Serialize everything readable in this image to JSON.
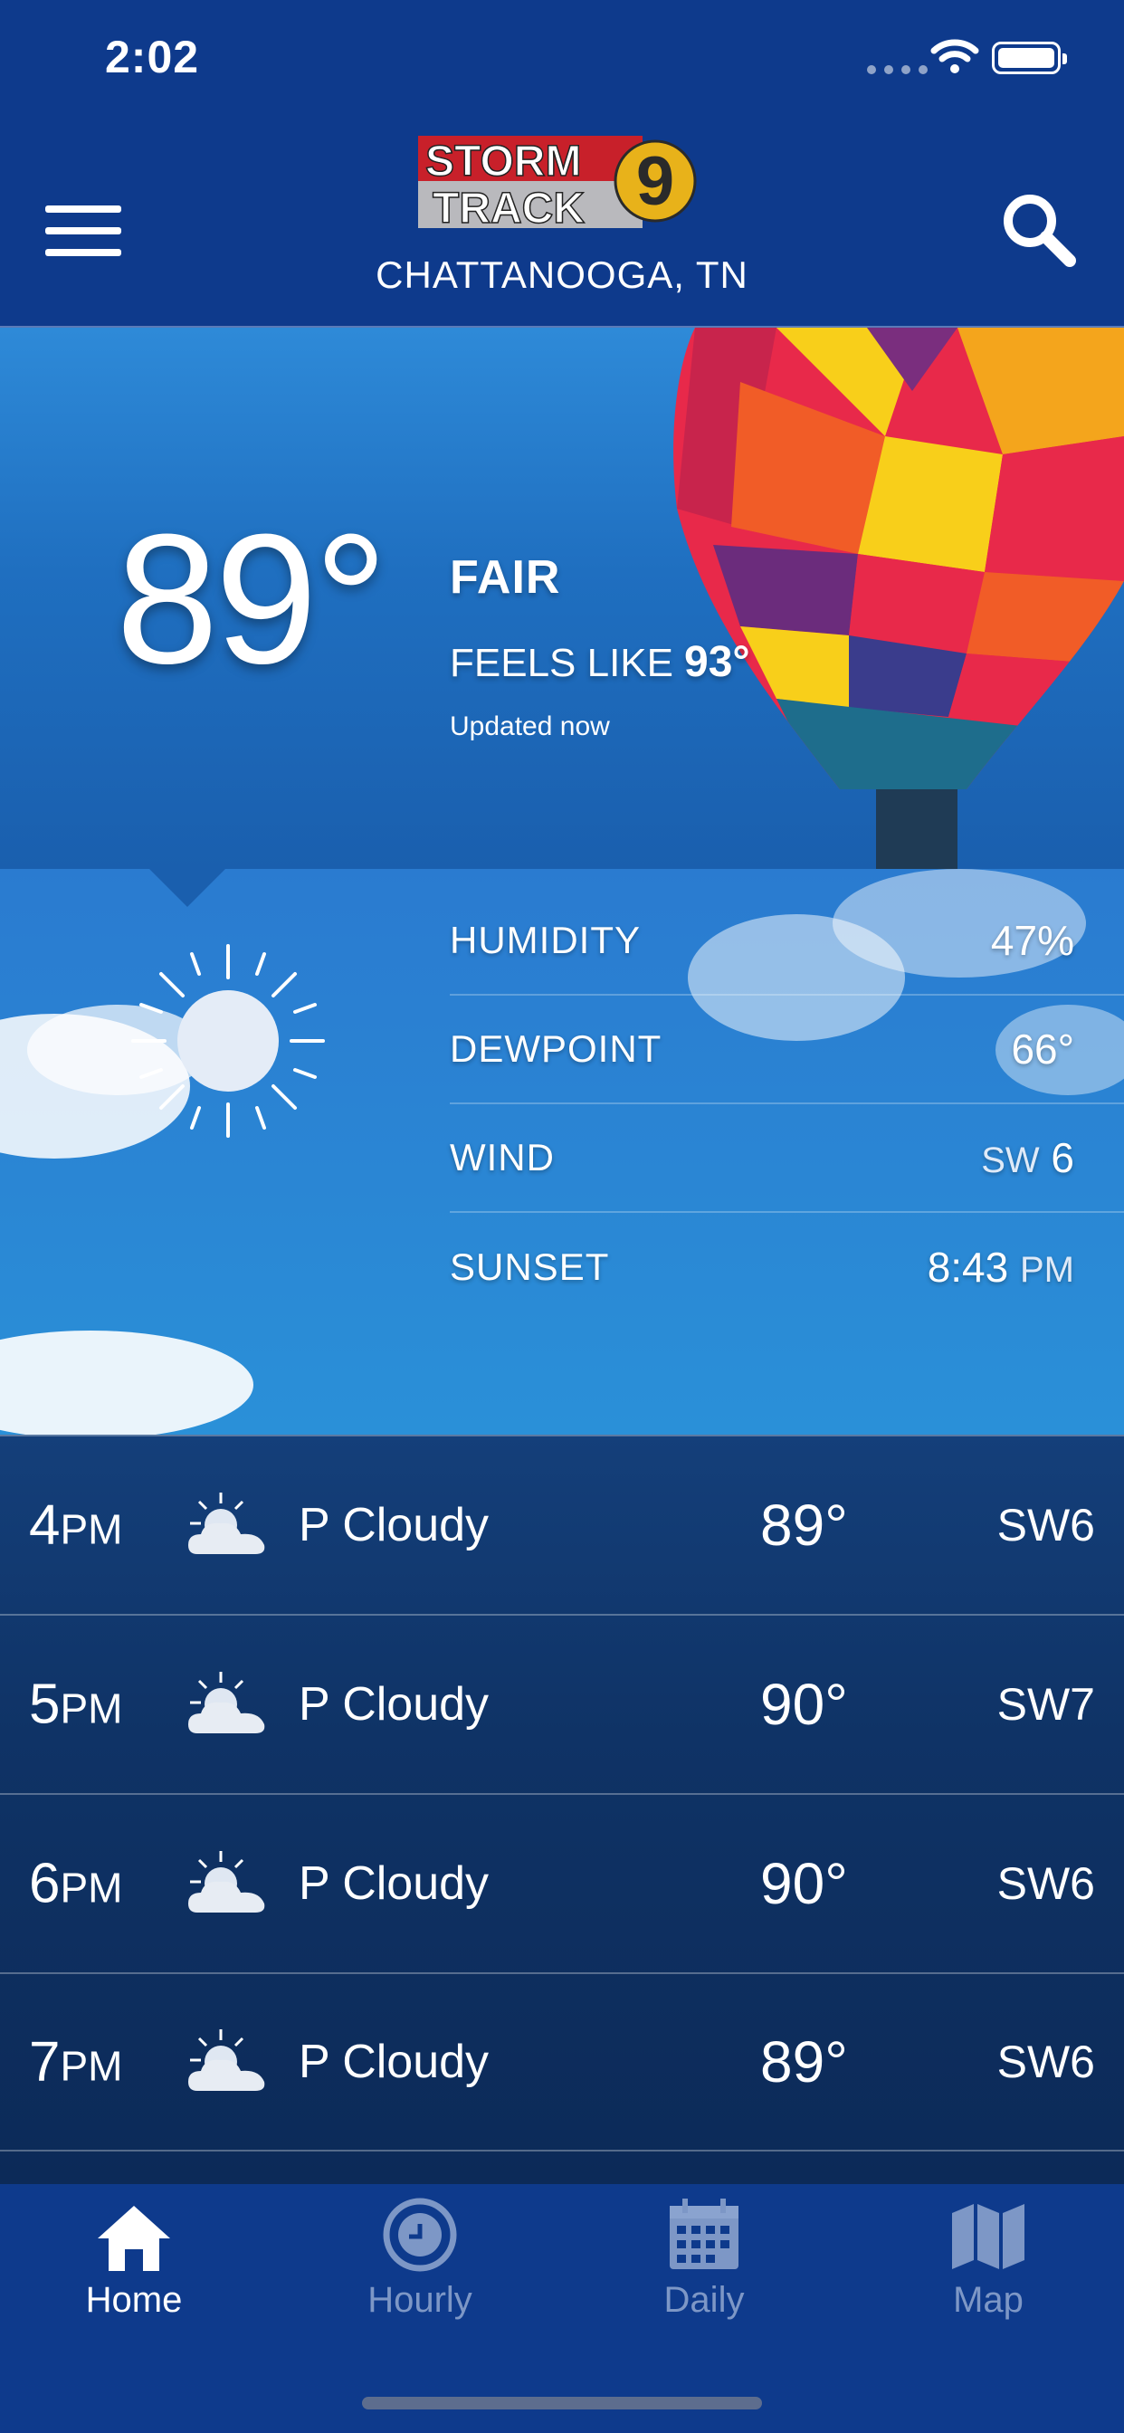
{
  "status_bar": {
    "time": "2:02"
  },
  "header": {
    "logo_text_line1": "STORM",
    "logo_text_line2": "TRACK",
    "logo_number": "9",
    "location": "CHATTANOOGA, TN"
  },
  "current": {
    "temperature": "89°",
    "condition": "FAIR",
    "feels_like_label": "FEELS LIKE",
    "feels_like_value": "93°",
    "updated": "Updated now",
    "icon": "sun-icon"
  },
  "details": [
    {
      "label": "HUMIDITY",
      "value": "47%",
      "unit": ""
    },
    {
      "label": "DEWPOINT",
      "value": "66°",
      "unit": ""
    },
    {
      "label": "WIND",
      "value": "6",
      "unit": "SW"
    },
    {
      "label": "SUNSET",
      "value": "8:43",
      "unit": "PM"
    }
  ],
  "hourly": [
    {
      "hour": "4",
      "ampm": "PM",
      "condition": "P Cloudy",
      "temp": "89°",
      "wind": "SW6",
      "icon": "partly-cloudy-icon"
    },
    {
      "hour": "5",
      "ampm": "PM",
      "condition": "P Cloudy",
      "temp": "90°",
      "wind": "SW7",
      "icon": "partly-cloudy-icon"
    },
    {
      "hour": "6",
      "ampm": "PM",
      "condition": "P Cloudy",
      "temp": "90°",
      "wind": "SW6",
      "icon": "partly-cloudy-icon"
    },
    {
      "hour": "7",
      "ampm": "PM",
      "condition": "P Cloudy",
      "temp": "89°",
      "wind": "SW6",
      "icon": "partly-cloudy-icon"
    }
  ],
  "tabs": [
    {
      "label": "Home",
      "icon": "home-icon",
      "active": true
    },
    {
      "label": "Hourly",
      "icon": "clock-icon",
      "active": false
    },
    {
      "label": "Daily",
      "icon": "calendar-icon",
      "active": false
    },
    {
      "label": "Map",
      "icon": "map-icon",
      "active": false
    }
  ],
  "colors": {
    "brand_blue": "#0e3a8c",
    "logo_red": "#c8202a",
    "logo_gold": "#e8b21a",
    "inactive_tab": "#7d97c6"
  }
}
